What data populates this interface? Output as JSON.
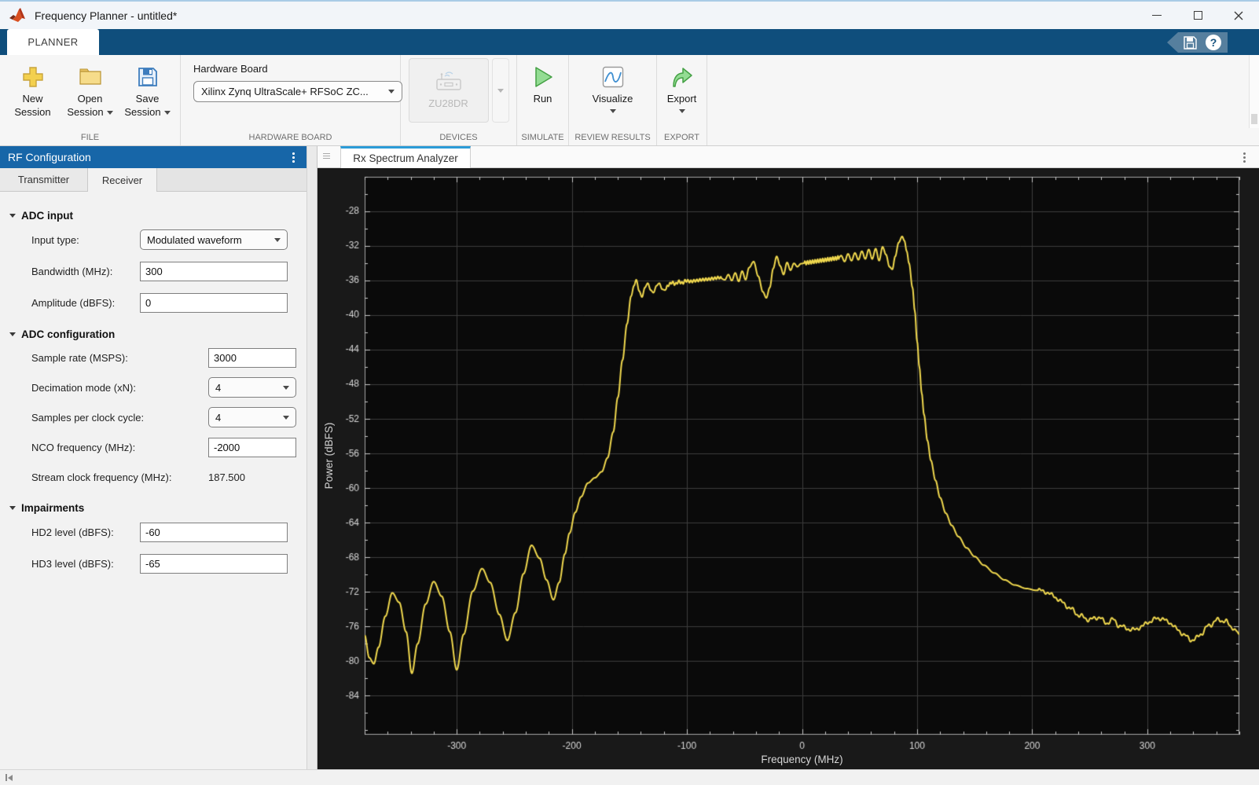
{
  "window": {
    "title": "Frequency Planner - untitled*"
  },
  "ribbon": {
    "tab_label": "PLANNER"
  },
  "icons": {
    "help_glyph": "?"
  },
  "toolbar": {
    "file": {
      "caption": "FILE",
      "new_line1": "New",
      "new_line2": "Session",
      "open_line1": "Open",
      "open_line2": "Session",
      "save_line1": "Save",
      "save_line2": "Session"
    },
    "hardware_board": {
      "caption": "HARDWARE BOARD",
      "label": "Hardware Board",
      "selected": "Xilinx Zynq UltraScale+ RFSoC ZC..."
    },
    "devices": {
      "caption": "DEVICES",
      "device_label": "ZU28DR"
    },
    "simulate": {
      "caption": "SIMULATE",
      "run_label": "Run"
    },
    "review_results": {
      "caption": "REVIEW RESULTS",
      "visualize_label": "Visualize"
    },
    "export": {
      "caption": "EXPORT",
      "export_label": "Export"
    }
  },
  "left_panel": {
    "title": "RF Configuration",
    "tab_transmitter": "Transmitter",
    "tab_receiver": "Receiver",
    "adc_input": {
      "title": "ADC input",
      "input_type_label": "Input type:",
      "input_type_value": "Modulated waveform",
      "bandwidth_label": "Bandwidth (MHz):",
      "bandwidth_value": "300",
      "amplitude_label": "Amplitude (dBFS):",
      "amplitude_value": "0"
    },
    "adc_configuration": {
      "title": "ADC configuration",
      "sample_rate_label": "Sample rate (MSPS):",
      "sample_rate_value": "3000",
      "decimation_label": "Decimation mode (xN):",
      "decimation_value": "4",
      "samples_per_clock_label": "Samples per clock cycle:",
      "samples_per_clock_value": "4",
      "nco_label": "NCO frequency (MHz):",
      "nco_value": "-2000",
      "stream_clock_label": "Stream clock frequency (MHz):",
      "stream_clock_value": "187.500"
    },
    "impairments": {
      "title": "Impairments",
      "hd2_label": "HD2 level (dBFS):",
      "hd2_value": "-60",
      "hd3_label": "HD3 level (dBFS):",
      "hd3_value": "-65"
    }
  },
  "right_panel": {
    "tab_label": "Rx Spectrum Analyzer"
  },
  "chart_data": {
    "type": "line",
    "title": "Rx Spectrum Analyzer",
    "xlabel": "Frequency (MHz)",
    "ylabel": "Power (dBFS)",
    "xlim": [
      -380,
      380
    ],
    "ylim": [
      -88.5,
      -24
    ],
    "x_ticks_major": [
      -300,
      -200,
      -100,
      0,
      100,
      200,
      300
    ],
    "y_ticks_major": [
      -28,
      -32,
      -36,
      -40,
      -44,
      -48,
      -52,
      -56,
      -60,
      -64,
      -68,
      -72,
      -76,
      -80,
      -84
    ],
    "x_minor_step": 20,
    "y_minor_step": 2,
    "grid": true,
    "legend": "none",
    "figure_bg": "#191919",
    "axes_bg": "#0a0a0a",
    "grid_color": "#3d3d3d",
    "tick_color": "#c8c8c8",
    "label_color": "#d6d6d6",
    "trace_color": "#f0d84e",
    "series": [
      {
        "name": "Rx spectrum",
        "anchors": [
          [
            -380,
            -77.0
          ],
          [
            -376,
            -79.6
          ],
          [
            -372,
            -80.3
          ],
          [
            -368,
            -78.4
          ],
          [
            -362,
            -74.8
          ],
          [
            -356,
            -72.1
          ],
          [
            -350,
            -73.2
          ],
          [
            -344,
            -76.6
          ],
          [
            -339,
            -81.4
          ],
          [
            -334,
            -78.0
          ],
          [
            -327,
            -73.4
          ],
          [
            -320,
            -70.8
          ],
          [
            -313,
            -72.5
          ],
          [
            -306,
            -76.6
          ],
          [
            -300,
            -81.0
          ],
          [
            -294,
            -76.9
          ],
          [
            -286,
            -71.9
          ],
          [
            -278,
            -69.3
          ],
          [
            -271,
            -70.9
          ],
          [
            -263,
            -74.6
          ],
          [
            -256,
            -77.6
          ],
          [
            -249,
            -74.4
          ],
          [
            -242,
            -69.9
          ],
          [
            -235,
            -66.6
          ],
          [
            -228,
            -68.1
          ],
          [
            -222,
            -70.6
          ],
          [
            -216,
            -72.9
          ],
          [
            -211,
            -70.9
          ],
          [
            -206,
            -67.6
          ],
          [
            -202,
            -65.2
          ],
          [
            -197,
            -62.8
          ],
          [
            -192,
            -61.0
          ],
          [
            -186,
            -59.4
          ],
          [
            -180,
            -58.8
          ],
          [
            -174,
            -58.1
          ],
          [
            -169,
            -56.5
          ],
          [
            -164,
            -53.5
          ],
          [
            -160,
            -49.5
          ],
          [
            -156,
            -45.2
          ],
          [
            -152,
            -41.0
          ],
          [
            -148.5,
            -37.8
          ],
          [
            -146,
            -36.6
          ],
          [
            -144,
            -35.9
          ],
          [
            -141.5,
            -37.2
          ],
          [
            -139,
            -37.9
          ],
          [
            -136.5,
            -36.8
          ],
          [
            -134,
            -36.3
          ],
          [
            -131.5,
            -37.1
          ],
          [
            -129,
            -37.4
          ],
          [
            -126.5,
            -36.6
          ],
          [
            -124,
            -36.3
          ],
          [
            -121.5,
            -37.0
          ],
          [
            -119,
            -37.1
          ],
          [
            -116,
            -36.5
          ],
          [
            -113,
            -36.2
          ],
          [
            -110,
            -36.4
          ],
          [
            -107,
            -36.1
          ],
          [
            -104,
            -36.3
          ],
          [
            -101,
            -36.0
          ],
          [
            -97,
            -36.1
          ],
          [
            -92,
            -36.0
          ],
          [
            -87,
            -35.9
          ],
          [
            -82,
            -35.85
          ],
          [
            -77,
            -35.75
          ],
          [
            -72,
            -35.65
          ],
          [
            -67,
            -35.9
          ],
          [
            -64,
            -35.3
          ],
          [
            -61,
            -36.0
          ],
          [
            -58,
            -35.1
          ],
          [
            -55,
            -36.1
          ],
          [
            -52,
            -34.9
          ],
          [
            -49,
            -35.9
          ],
          [
            -46,
            -34.5
          ],
          [
            -42,
            -33.8
          ],
          [
            -38,
            -35.5
          ],
          [
            -34,
            -37.3
          ],
          [
            -31,
            -38.0
          ],
          [
            -28,
            -36.8
          ],
          [
            -25,
            -34.6
          ],
          [
            -22,
            -33.2
          ],
          [
            -19,
            -34.3
          ],
          [
            -16,
            -35.3
          ],
          [
            -13,
            -33.9
          ],
          [
            -10,
            -34.8
          ],
          [
            -7,
            -34.0
          ],
          [
            -4,
            -34.4
          ],
          [
            -1,
            -34.05
          ],
          [
            3,
            -33.95
          ],
          [
            8,
            -33.85
          ],
          [
            13,
            -33.75
          ],
          [
            18,
            -33.65
          ],
          [
            23,
            -33.55
          ],
          [
            28,
            -33.45
          ],
          [
            32,
            -33.35
          ],
          [
            34,
            -33.1
          ],
          [
            37,
            -33.8
          ],
          [
            40,
            -32.9
          ],
          [
            43,
            -33.7
          ],
          [
            46,
            -32.8
          ],
          [
            49,
            -33.6
          ],
          [
            52,
            -32.6
          ],
          [
            55,
            -33.5
          ],
          [
            58,
            -32.4
          ],
          [
            61,
            -33.5
          ],
          [
            64,
            -32.3
          ],
          [
            67,
            -33.7
          ],
          [
            70,
            -32.1
          ],
          [
            73,
            -33.0
          ],
          [
            76,
            -34.4
          ],
          [
            78.5,
            -34.7
          ],
          [
            81,
            -33.2
          ],
          [
            84,
            -31.6
          ],
          [
            87,
            -30.9
          ],
          [
            89,
            -31.4
          ],
          [
            91,
            -32.6
          ],
          [
            93,
            -34.0
          ],
          [
            96,
            -36.8
          ],
          [
            98,
            -39.5
          ],
          [
            100,
            -43.0
          ],
          [
            102,
            -46.0
          ],
          [
            104,
            -49.0
          ],
          [
            106,
            -51.5
          ],
          [
            109,
            -54.5
          ],
          [
            112,
            -56.8
          ],
          [
            116,
            -59.1
          ],
          [
            120,
            -61.1
          ],
          [
            125,
            -62.9
          ],
          [
            130,
            -64.3
          ],
          [
            136,
            -65.6
          ],
          [
            143,
            -66.9
          ],
          [
            150,
            -67.9
          ],
          [
            158,
            -68.9
          ],
          [
            167,
            -69.8
          ],
          [
            176,
            -70.6
          ],
          [
            185,
            -71.2
          ],
          [
            195,
            -71.6
          ],
          [
            203,
            -71.8
          ],
          [
            210,
            -71.9
          ],
          [
            218,
            -72.4
          ],
          [
            226,
            -73.2
          ],
          [
            234,
            -74.0
          ],
          [
            242,
            -74.8
          ],
          [
            250,
            -75.2
          ],
          [
            258,
            -74.9
          ],
          [
            264,
            -75.6
          ],
          [
            270,
            -75.2
          ],
          [
            276,
            -75.9
          ],
          [
            282,
            -76.2
          ],
          [
            288,
            -76.4
          ],
          [
            295,
            -76.0
          ],
          [
            302,
            -75.4
          ],
          [
            310,
            -75.0
          ],
          [
            318,
            -75.4
          ],
          [
            326,
            -76.3
          ],
          [
            333,
            -77.1
          ],
          [
            340,
            -77.6
          ],
          [
            347,
            -76.8
          ],
          [
            354,
            -75.8
          ],
          [
            362,
            -75.2
          ],
          [
            368,
            -75.4
          ],
          [
            373,
            -76.0
          ],
          [
            378,
            -76.6
          ],
          [
            380,
            -76.9
          ]
        ],
        "fine_ripples": [
          {
            "from": -118,
            "to": -70,
            "period": 2.6,
            "amp": 0.16
          },
          {
            "from": 2,
            "to": 32,
            "period": 2.2,
            "amp": 0.22
          },
          {
            "from": 205,
            "to": 378,
            "period": 9.0,
            "amp": 0.18
          },
          {
            "from": 205,
            "to": 378,
            "period": 3.7,
            "amp": 0.12
          }
        ]
      }
    ]
  }
}
